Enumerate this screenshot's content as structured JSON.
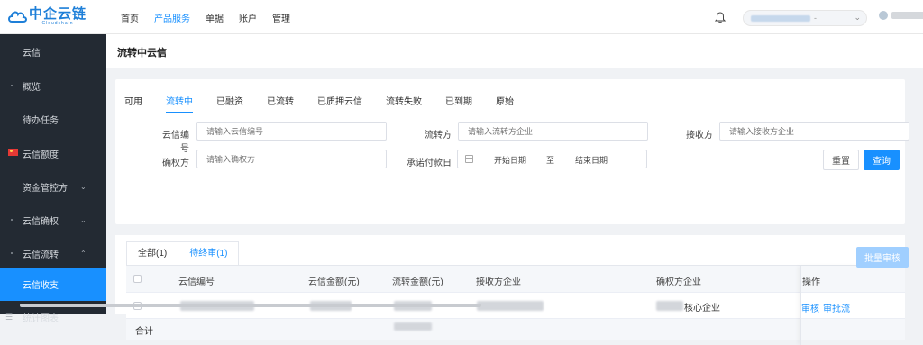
{
  "logo": {
    "main": "中企云链",
    "sub": "Cloudchain"
  },
  "topnav": [
    "首页",
    "产品服务",
    "单据",
    "账户",
    "管理"
  ],
  "topnav_active": "产品服务",
  "header": {
    "org_suffix": "-"
  },
  "sidebar": {
    "items": [
      {
        "label": "云信",
        "chevron": ""
      },
      {
        "label": "概览",
        "chevron": ""
      },
      {
        "label": "待办任务",
        "chevron": ""
      },
      {
        "label": "云信额度",
        "chevron": ""
      },
      {
        "label": "资金管控方",
        "chevron": "⌄"
      },
      {
        "label": "云信确权",
        "chevron": "⌄"
      },
      {
        "label": "云信流转",
        "chevron": "⌃"
      },
      {
        "label": "云信收支",
        "chevron": ""
      },
      {
        "label": "统计图表",
        "chevron": ""
      }
    ]
  },
  "page_title": "流转中云信",
  "status_tabs": [
    "可用",
    "流转中",
    "已融资",
    "已流转",
    "已质押云信",
    "流转失败",
    "已到期",
    "原始"
  ],
  "status_tab_active": "流转中",
  "filters": {
    "yunxin_no": {
      "label": "云信编号",
      "placeholder": "请输入云信编号"
    },
    "transferor": {
      "label": "流转方",
      "placeholder": "请输入流转方企业"
    },
    "receiver": {
      "label": "接收方",
      "placeholder": "请输入接收方企业"
    },
    "confirmer": {
      "label": "确权方",
      "placeholder": "请输入确权方"
    },
    "pay_date": {
      "label": "承诺付款日",
      "start": "开始日期",
      "sep": "至",
      "end": "结束日期"
    }
  },
  "buttons": {
    "reset": "重置",
    "query": "查询",
    "batch_review": "批量审核"
  },
  "list_tabs": [
    "全部(1)",
    "待终审(1)"
  ],
  "list_tab_active": "待终审(1)",
  "table": {
    "columns": [
      "云信编号",
      "云信金额(元)",
      "流转金额(元)",
      "接收方企业",
      "确权方企业",
      "操作"
    ],
    "rows": [
      {
        "confirmer_suffix": "核心企业",
        "actions": [
          "审核",
          "审批流"
        ]
      }
    ],
    "summary_label": "合计"
  }
}
